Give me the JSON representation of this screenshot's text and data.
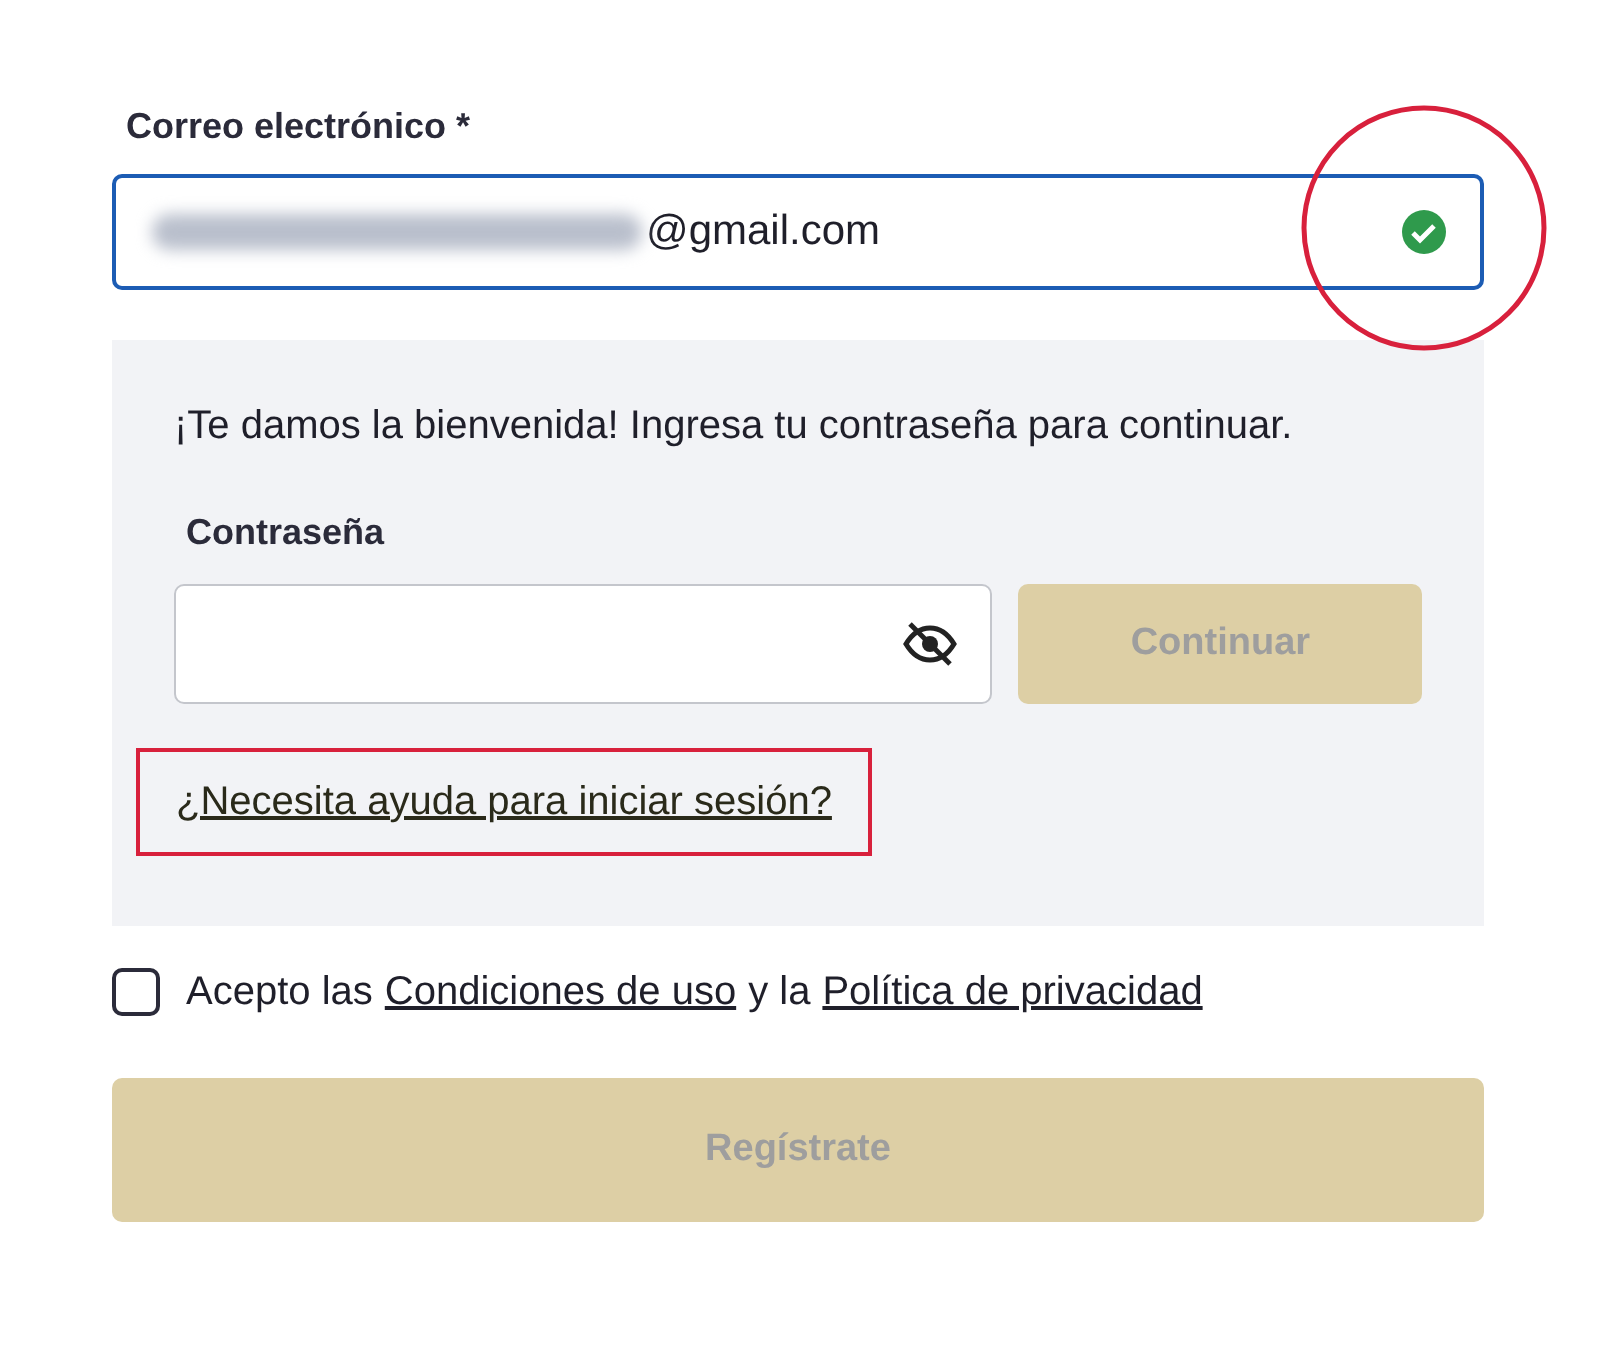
{
  "email": {
    "label": "Correo electrónico *",
    "value": "@gmail.com",
    "redacted": true,
    "valid": true,
    "highlighted": true
  },
  "password_panel": {
    "message": "¡Te damos la bienvenida! Ingresa tu contraseña para continuar.",
    "label": "Contraseña",
    "continue_button": {
      "label": "Continuar",
      "disabled": true
    },
    "help_link": {
      "label": "¿Necesita ayuda para iniciar sesión?",
      "highlighted": true
    }
  },
  "terms": {
    "checked": false,
    "parts": [
      {
        "kind": "text",
        "text": "Acepto las"
      },
      {
        "kind": "link",
        "text": "Condiciones de uso"
      },
      {
        "kind": "text",
        "text": "y la"
      },
      {
        "kind": "link",
        "text": "Política de privacidad"
      }
    ]
  },
  "register_button": {
    "label": "Regístrate",
    "disabled": true
  }
}
